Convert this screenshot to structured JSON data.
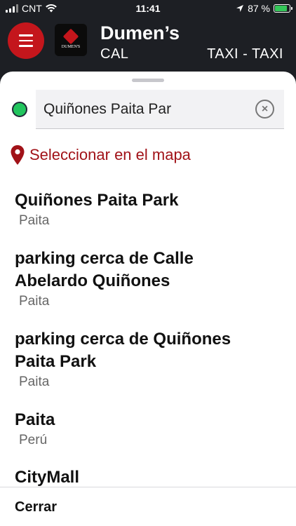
{
  "status_bar": {
    "carrier": "CNT",
    "time": "11:41",
    "battery": "87 %",
    "battery_level": 0.87
  },
  "header": {
    "title": "Dumen’s",
    "logo_text": "DUMEN'S",
    "marquee_left": "CAL",
    "marquee_right": "TAXI - TAXI"
  },
  "search": {
    "value": "Quiñones Paita Par",
    "clear_symbol": "×"
  },
  "map_select": {
    "label": "Seleccionar en el mapa",
    "icon": "location-pin-icon",
    "color": "#a11218"
  },
  "results": [
    {
      "title": "Quiñones Paita Park",
      "subtitle": "Paita"
    },
    {
      "title": "parking cerca de Calle\nAbelardo Quiñones",
      "subtitle": "Paita"
    },
    {
      "title": "parking cerca de Quiñones\nPaita Park",
      "subtitle": "Paita"
    },
    {
      "title": "Paita",
      "subtitle": "Perú"
    },
    {
      "title": "CityMall",
      "subtitle": ""
    }
  ],
  "footer": {
    "close_label": "Cerrar"
  },
  "colors": {
    "accent": "#c4161c",
    "origin_dot": "#22c55e"
  }
}
